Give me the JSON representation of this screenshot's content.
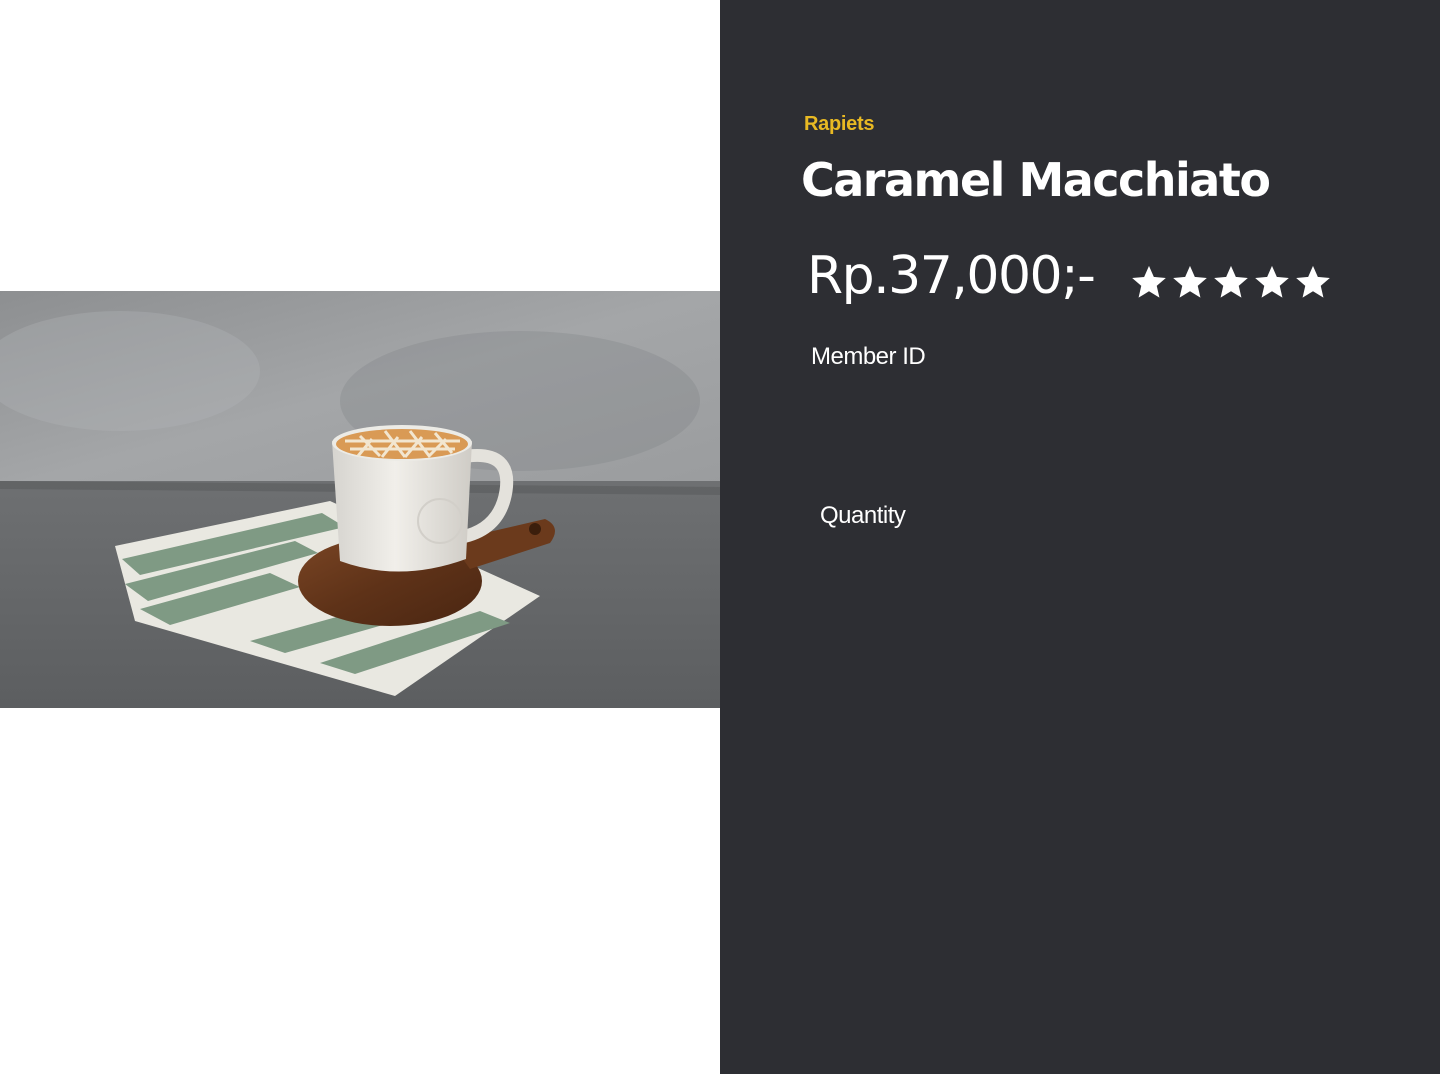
{
  "product": {
    "brand": "Rapiets",
    "title": "Caramel Macchiato",
    "price": "Rp.37,000;-",
    "rating": 5,
    "rating_max": 5,
    "image_icon": "caramel-macchiato-photo"
  },
  "form": {
    "member_label": "Member ID",
    "quantity_label": "Quantity"
  },
  "colors": {
    "panel_background": "#2d2e33",
    "brand_accent": "#e8b923",
    "text": "#ffffff"
  }
}
